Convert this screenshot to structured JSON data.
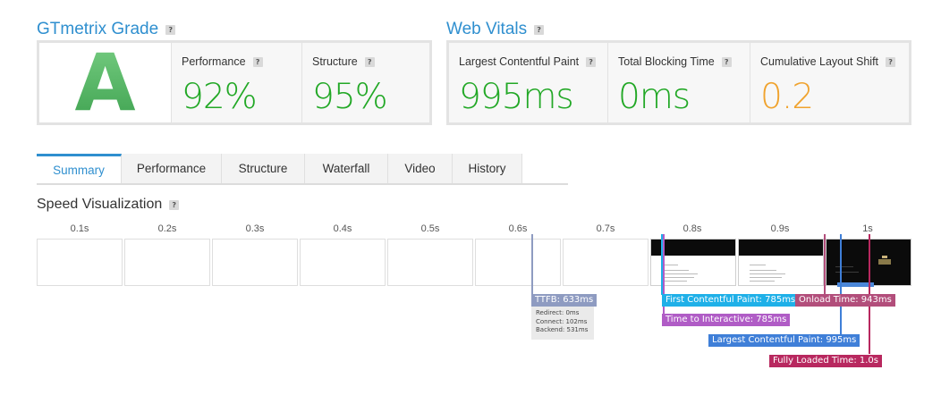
{
  "grade_section": {
    "title": "GTmetrix Grade",
    "help": "?",
    "grade": "A",
    "performance": {
      "label": "Performance",
      "value": "92%",
      "color": "#22a826"
    },
    "structure": {
      "label": "Structure",
      "value": "95%",
      "color": "#22a826"
    }
  },
  "vitals_section": {
    "title": "Web Vitals",
    "help": "?",
    "lcp": {
      "label": "Largest Contentful Paint",
      "value": "995ms",
      "color": "#22a826"
    },
    "tbt": {
      "label": "Total Blocking Time",
      "value": "0ms",
      "color": "#22a826"
    },
    "cls": {
      "label": "Cumulative Layout Shift",
      "value": "0.2",
      "color": "#f0a32e"
    }
  },
  "tabs": [
    {
      "label": "Summary",
      "active": true
    },
    {
      "label": "Performance",
      "active": false
    },
    {
      "label": "Structure",
      "active": false
    },
    {
      "label": "Waterfall",
      "active": false
    },
    {
      "label": "Video",
      "active": false
    },
    {
      "label": "History",
      "active": false
    }
  ],
  "speed": {
    "title": "Speed Visualization",
    "help": "?",
    "ticks": [
      "0.1s",
      "0.2s",
      "0.3s",
      "0.4s",
      "0.5s",
      "0.6s",
      "0.7s",
      "0.8s",
      "0.9s",
      "1s"
    ],
    "markers": {
      "ttfb": {
        "label": "TTFB: 633ms",
        "color": "#8e9bc1"
      },
      "ttfb_redirect": "Redirect: 0ms",
      "ttfb_connect": "Connect: 102ms",
      "ttfb_backend": "Backend: 531ms",
      "fcp": {
        "label": "First Contentful Paint: 785ms",
        "color": "#1fb0e8"
      },
      "tti": {
        "label": "Time to Interactive: 785ms",
        "color": "#b05cc6"
      },
      "lcp": {
        "label": "Largest Contentful Paint: 995ms",
        "color": "#3f7fd8"
      },
      "onload": {
        "label": "Onload Time: 943ms",
        "color": "#b24e7b"
      },
      "fully_loaded": {
        "label": "Fully Loaded Time: 1.0s",
        "color": "#b8285f"
      }
    }
  }
}
